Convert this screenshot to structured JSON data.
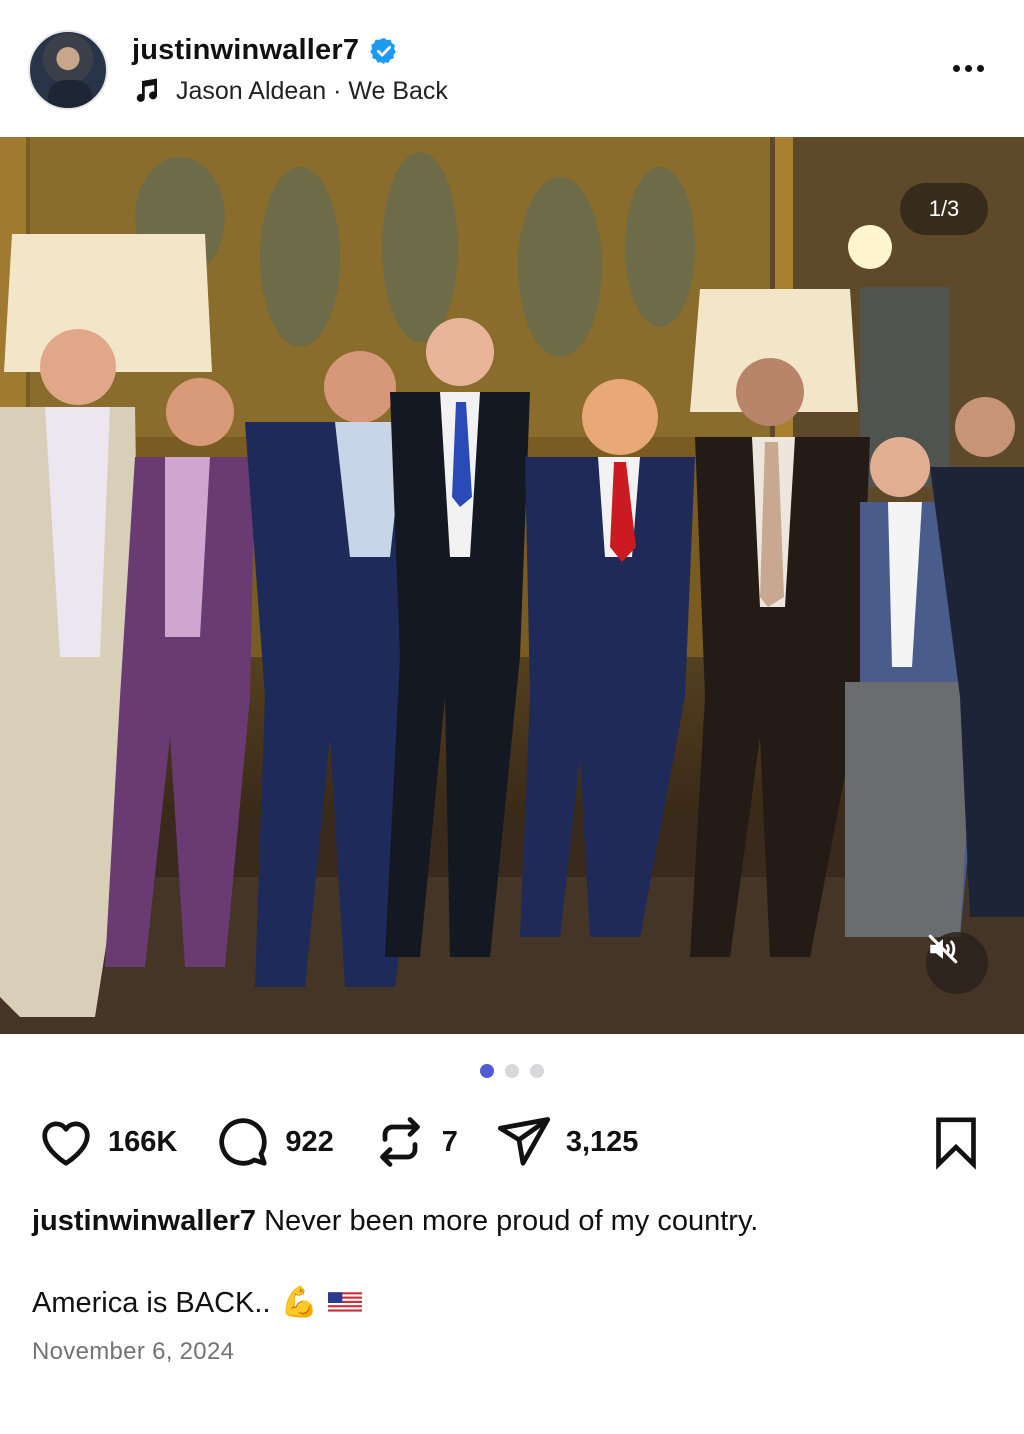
{
  "post": {
    "username": "justinwinwaller7",
    "music": "Jason Aldean · We Back",
    "carousel_counter": "1/3",
    "carousel_pages": 3,
    "carousel_active": 1
  },
  "actions": {
    "likes": "166K",
    "comments": "922",
    "reposts": "7",
    "shares": "3,125"
  },
  "caption": {
    "username": "justinwinwaller7",
    "text": "Never been more proud of my country.",
    "line2": "America is BACK..",
    "emoji_arm": "💪",
    "date": "November 6, 2024"
  },
  "icons": {
    "verified": "verified-badge-icon",
    "music": "music-note-icon",
    "more": "more-options-icon",
    "mute": "muted-speaker-icon",
    "like": "heart-icon",
    "comment": "comment-bubble-icon",
    "repost": "repost-icon",
    "share": "send-icon",
    "save": "bookmark-icon"
  },
  "colors": {
    "verified": "#1d9bf0",
    "active_dot": "#4f5bd5",
    "inactive_dot": "#d8d8dc",
    "date": "#737373"
  }
}
